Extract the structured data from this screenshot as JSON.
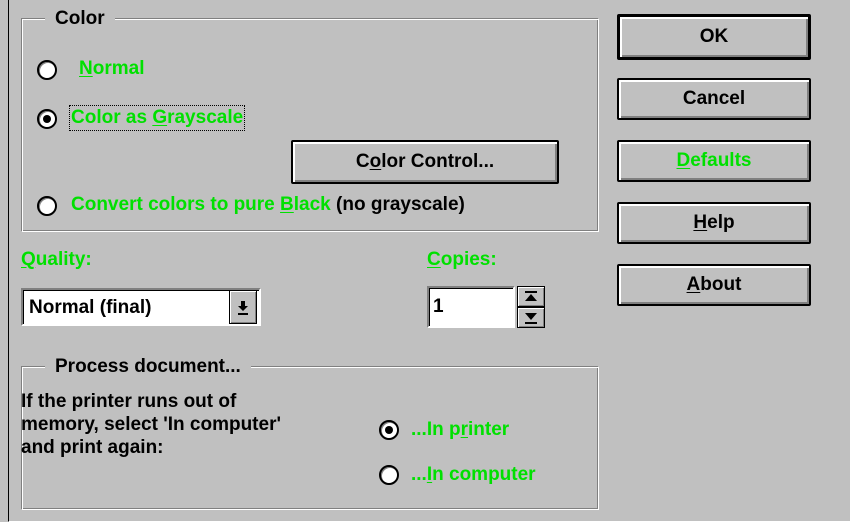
{
  "color_group": {
    "title": "Color",
    "normal": {
      "prefix": "",
      "mnemonic": "N",
      "suffix": "ormal",
      "selected": false
    },
    "grayscale": {
      "prefix": "Color as ",
      "mnemonic": "G",
      "suffix": "rayscale",
      "selected": true
    },
    "color_control_button": {
      "mnemonic": "o",
      "prefix": "C",
      "suffix": "lor Control..."
    },
    "black": {
      "prefix": "Convert colors to pure ",
      "mnemonic": "B",
      "suffix": "lack",
      "note": "(no grayscale)",
      "selected": false
    }
  },
  "quality": {
    "label_mnemonic": "Q",
    "label_rest": "uality:",
    "value": "Normal (final)"
  },
  "copies": {
    "label_mnemonic": "C",
    "label_rest": "opies:",
    "value": "1"
  },
  "process_group": {
    "title": "Process document...",
    "description_lines": [
      "If the printer runs out of",
      "memory, select 'In computer'",
      "and print again:"
    ],
    "in_printer": {
      "prefix": "...In p",
      "mnemonic": "r",
      "suffix": "inter",
      "selected": true
    },
    "in_computer": {
      "prefix": "...",
      "mnemonic": "I",
      "suffix": "n computer",
      "selected": false
    }
  },
  "buttons": {
    "ok": "OK",
    "cancel": "Cancel",
    "defaults": {
      "mnemonic": "D",
      "rest": "efaults"
    },
    "help": {
      "mnemonic": "H",
      "rest": "elp"
    },
    "about": {
      "mnemonic": "A",
      "rest": "bout"
    }
  },
  "colors": {
    "accent_text": "#00e000",
    "face": "#c0c0c0"
  }
}
